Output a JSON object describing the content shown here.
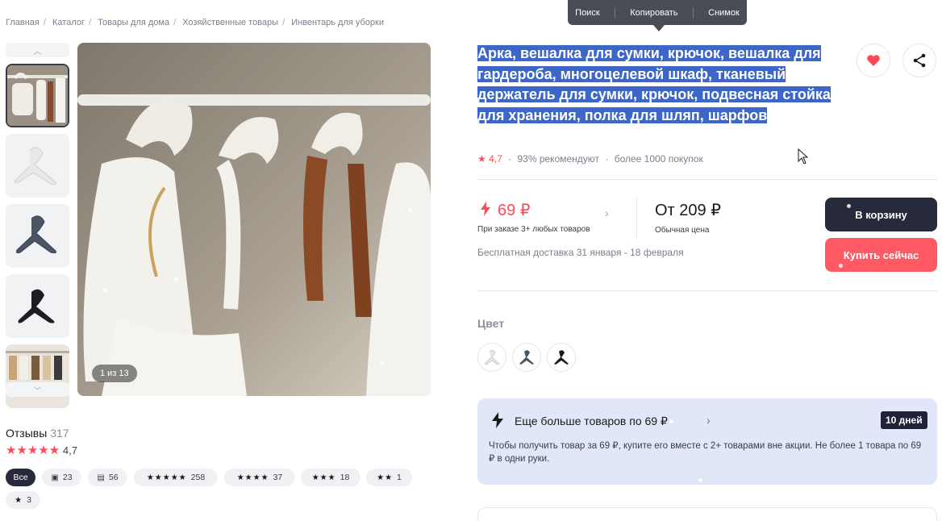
{
  "breadcrumb": [
    "Главная",
    "Каталог",
    "Товары для дома",
    "Хозяйственные товары",
    "Инвентарь для уборки"
  ],
  "context_menu": {
    "search": "Поиск",
    "copy": "Копировать",
    "snapshot": "Снимок"
  },
  "gallery": {
    "counter": "1 из 13"
  },
  "product": {
    "title": "Арка, вешалка для сумки, крючок, вешалка для гардероба, многоцелевой шкаф, тканевый держатель для сумки, крючок, подвесная стойка для хранения, полка для шляп, шарфов",
    "rating": "4,7",
    "recommend": "93% рекомендуют",
    "purchases": "более 1000 покупок"
  },
  "pricing": {
    "promo_price": "69 ₽",
    "promo_note": "При заказе 3+ любых товаров",
    "regular_price": "От 209 ₽",
    "regular_note": "Обычная цена",
    "delivery": "Бесплатная доставка 31 января - 18 февраля"
  },
  "actions": {
    "cart": "В корзину",
    "buy": "Купить сейчас"
  },
  "color": {
    "label": "Цвет"
  },
  "promo_box": {
    "title": "Еще больше товаров по 69 ₽",
    "days": "10 дней",
    "description": "Чтобы получить товар за 69 ₽, купите его вместе с 2+ товарами вне акции. Не более 1 товара по 69 ₽ в одни руки."
  },
  "reviews": {
    "title": "Отзывы",
    "count": "317",
    "rating": "4,7",
    "filters": [
      {
        "label": "Все",
        "stars": ""
      },
      {
        "label": "23",
        "stars": ""
      },
      {
        "label": "56",
        "stars": ""
      },
      {
        "label": "258",
        "stars": "★★★★★"
      },
      {
        "label": "37",
        "stars": "★★★★"
      },
      {
        "label": "18",
        "stars": "★★★"
      },
      {
        "label": "1",
        "stars": "★★"
      },
      {
        "label": "3",
        "stars": "★"
      }
    ]
  },
  "colors": {
    "accent": "#ff4a5a",
    "selection": "#3d66c9",
    "dark_button": "#262a3a",
    "buy_button": "#ff5a63",
    "promo_bg": "#dfe7f8"
  }
}
